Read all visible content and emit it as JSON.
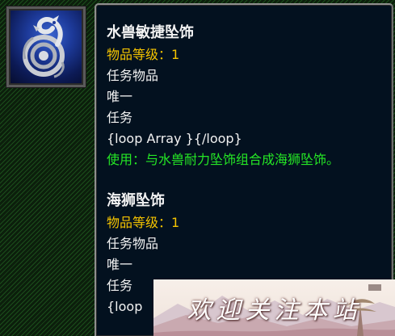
{
  "item_icon": "serpent-necklace-icon",
  "items": [
    {
      "name": "水兽敏捷坠饰",
      "item_level": "物品等级：1",
      "type": "任务物品",
      "uniqueness": "唯一",
      "category": "任务",
      "template_text": "{loop Array }{/loop}",
      "use_text": "使用：与水兽耐力坠饰组合成海狮坠饰。"
    },
    {
      "name": "海狮坠饰",
      "item_level": "物品等级：1",
      "type": "任务物品",
      "uniqueness": "唯一",
      "category": "任务",
      "template_text": "{loop"
    }
  ],
  "banner": {
    "text": "欢迎关注本站"
  },
  "colors": {
    "item_level": "#f5c400",
    "use_effect": "#25e625",
    "body_text": "#f2f2f2",
    "tooltip_background": "#03111f"
  }
}
